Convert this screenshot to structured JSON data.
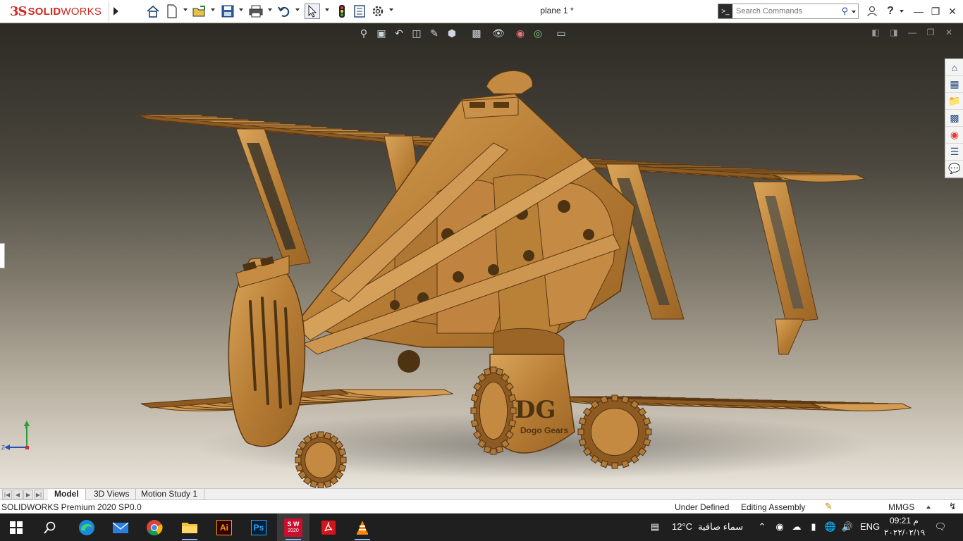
{
  "app": {
    "logo_ds": "3S",
    "logo_solid": "SOLID",
    "logo_works": "WORKS",
    "document_title": "plane 1 *"
  },
  "toolbar": {
    "icons": [
      "home-icon",
      "new-document-icon",
      "open-icon",
      "save-icon",
      "print-icon",
      "undo-icon",
      "select-icon",
      "rebuild-icon",
      "file-properties-icon",
      "options-icon"
    ]
  },
  "search": {
    "placeholder": "Search Commands"
  },
  "model": {
    "logo_text": "DG",
    "brand_text": "Dogo Gears"
  },
  "triad": {
    "y_label": "Y",
    "z_label": "Z"
  },
  "tabs": [
    {
      "label": "Model",
      "active": true
    },
    {
      "label": "3D Views",
      "active": false
    },
    {
      "label": "Motion Study 1",
      "active": false
    }
  ],
  "status": {
    "product": "SOLIDWORKS Premium 2020 SP0.0",
    "definition": "Under Defined",
    "mode": "Editing Assembly",
    "units": "MMGS"
  },
  "taskbar": {
    "solidworks_badge": "S W",
    "solidworks_year": "2020",
    "ai_label": "Ai",
    "ps_label": "Ps",
    "weather_temp": "12°C",
    "weather_desc": "سماء صافية",
    "lang": "ENG",
    "time": "09:21 م",
    "date": "٢٠٢٢/٠٢/١٩"
  },
  "colors": {
    "wood": "#c08a3e",
    "wood_dark": "#6e4418",
    "sw_red": "#d0291f",
    "taskbar": "#1f1f1f"
  }
}
